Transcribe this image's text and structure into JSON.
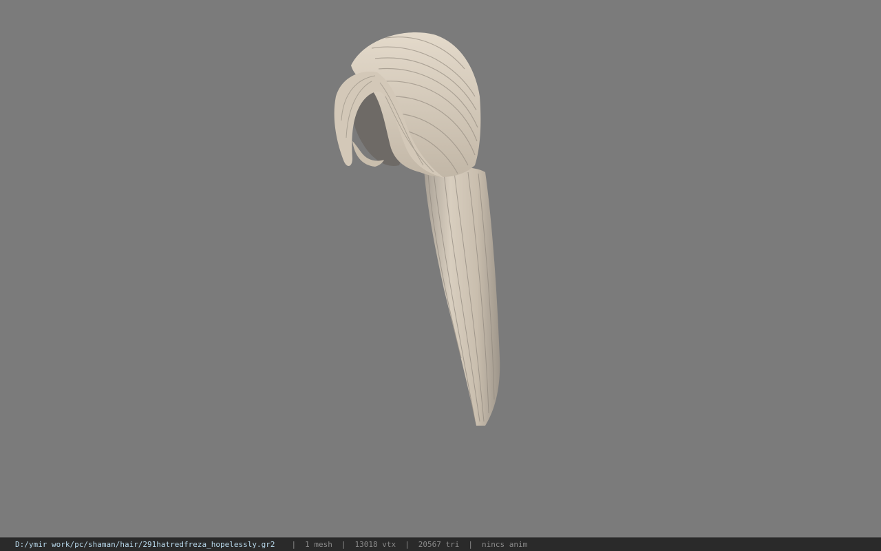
{
  "viewport": {
    "background_color": "#7b7b7b",
    "model": {
      "subject": "hair-mesh",
      "hair_color": "#d6cbbb",
      "shadow_color": "#8a8279"
    }
  },
  "statusbar": {
    "path": "D:/ymir work/pc/shaman/hair/291hatredfreza_hopelessly.gr2",
    "mesh_count": "1 mesh",
    "vertex_count": "13018 vtx",
    "triangle_count": "20567 tri",
    "anim_status": "nincs anim",
    "separator": "|",
    "path_color": "#b7d7ea",
    "text_color": "#8a8a8a"
  }
}
